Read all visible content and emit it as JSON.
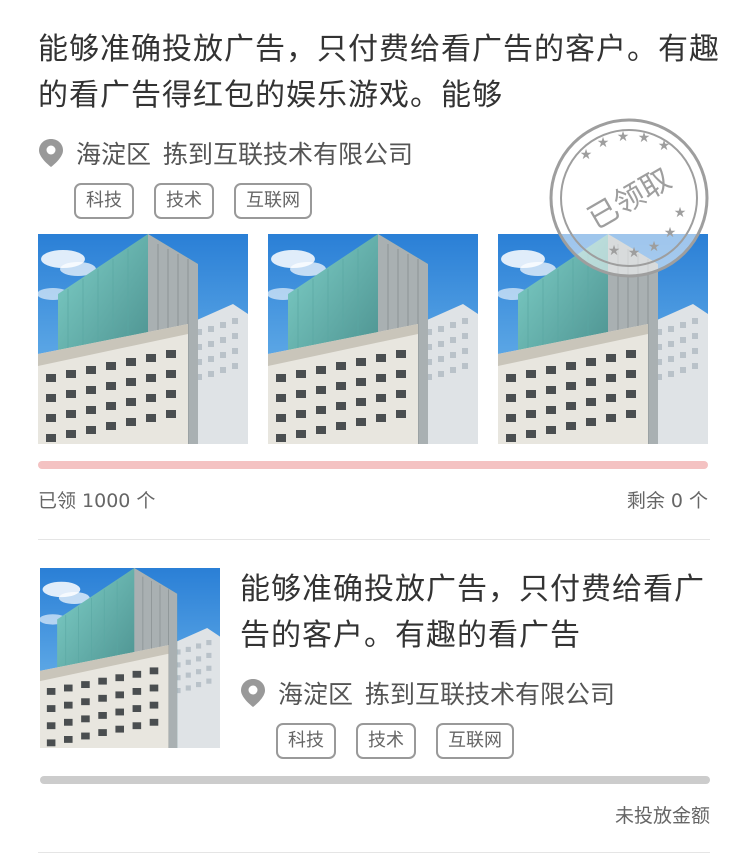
{
  "ads": [
    {
      "title": "能够准确投放广告，只付费给看广告的客户。有趣的看广告得红包的娱乐游戏。能够",
      "district": "海淀区",
      "company": "拣到互联技术有限公司",
      "tags": [
        "科技",
        "技术",
        "互联网"
      ],
      "stamp_text": "已领取",
      "progress_fraction": 1.0,
      "stat_left": "已领 1000 个",
      "stat_right": "剩余 0 个"
    },
    {
      "title": "能够准确投放广告，只付费给看广告的客户。有趣的看广告",
      "district": "海淀区",
      "company": "拣到互联技术有限公司",
      "tags": [
        "科技",
        "技术",
        "互联网"
      ],
      "progress_fraction": 0,
      "stat_right": "未投放金额"
    }
  ],
  "icons": {
    "location": "location-pin-icon",
    "stamp": "claimed-stamp"
  },
  "colors": {
    "title": "#333333",
    "meta": "#555555",
    "tag_border": "#999999",
    "progress_track_claimed": "#fbe3e3",
    "progress_track_unfunded": "#cccccc",
    "stamp": "#9e9e9e"
  }
}
